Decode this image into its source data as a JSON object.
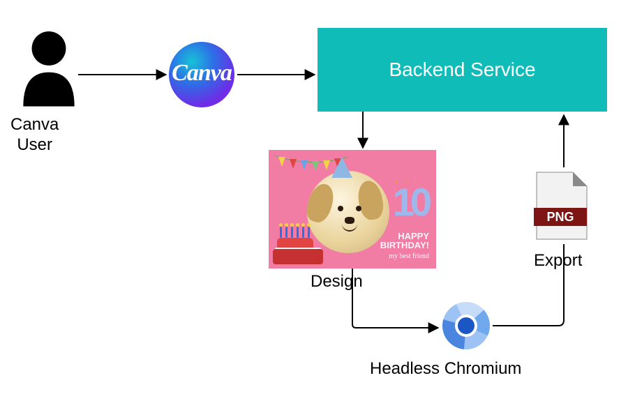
{
  "nodes": {
    "user": {
      "label_line1": "Canva",
      "label_line2": "User"
    },
    "canva": {
      "logo_text": "Canva"
    },
    "backend": {
      "label": "Backend Service"
    },
    "design": {
      "label": "Design",
      "card": {
        "number": "10",
        "happy": "HAPPY",
        "birthday": "BIRTHDAY!",
        "subtitle": "my best friend"
      }
    },
    "export": {
      "label": "Export",
      "file_badge": "PNG"
    },
    "chromium": {
      "label": "Headless Chromium"
    }
  },
  "colors": {
    "backend_bg": "#10bcb8",
    "design_bg": "#f17da4",
    "png_badge": "#7e1515"
  }
}
